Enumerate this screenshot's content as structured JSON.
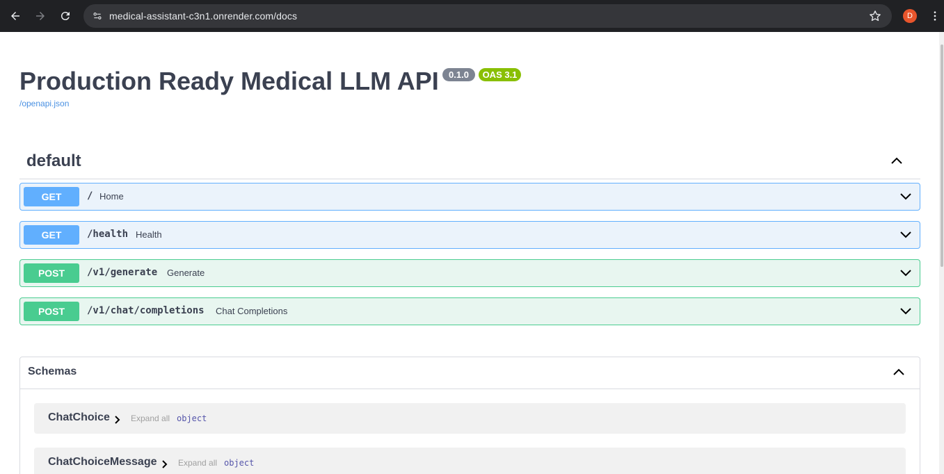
{
  "browser": {
    "url": "medical-assistant-c3n1.onrender.com/docs",
    "profile_initial": "D",
    "profile_color": "#e8552c"
  },
  "api": {
    "title": "Production Ready Medical LLM API",
    "version_badge": "0.1.0",
    "oas_badge": "OAS 3.1",
    "spec_link": "/openapi.json"
  },
  "tag": {
    "name": "default"
  },
  "operations": [
    {
      "method": "GET",
      "path": "/",
      "summary": "Home"
    },
    {
      "method": "GET",
      "path": "/health",
      "summary": "Health"
    },
    {
      "method": "POST",
      "path": "/v1/generate",
      "summary": "Generate"
    },
    {
      "method": "POST",
      "path": "/v1/chat/completions",
      "summary": "Chat Completions"
    }
  ],
  "schemas": {
    "title": "Schemas",
    "models": [
      {
        "name": "ChatChoice",
        "expand_label": "Expand all",
        "type": "object"
      },
      {
        "name": "ChatChoiceMessage",
        "expand_label": "Expand all",
        "type": "object"
      }
    ]
  },
  "colors": {
    "get": "#61affe",
    "post": "#49cc90",
    "text": "#3b4151"
  }
}
